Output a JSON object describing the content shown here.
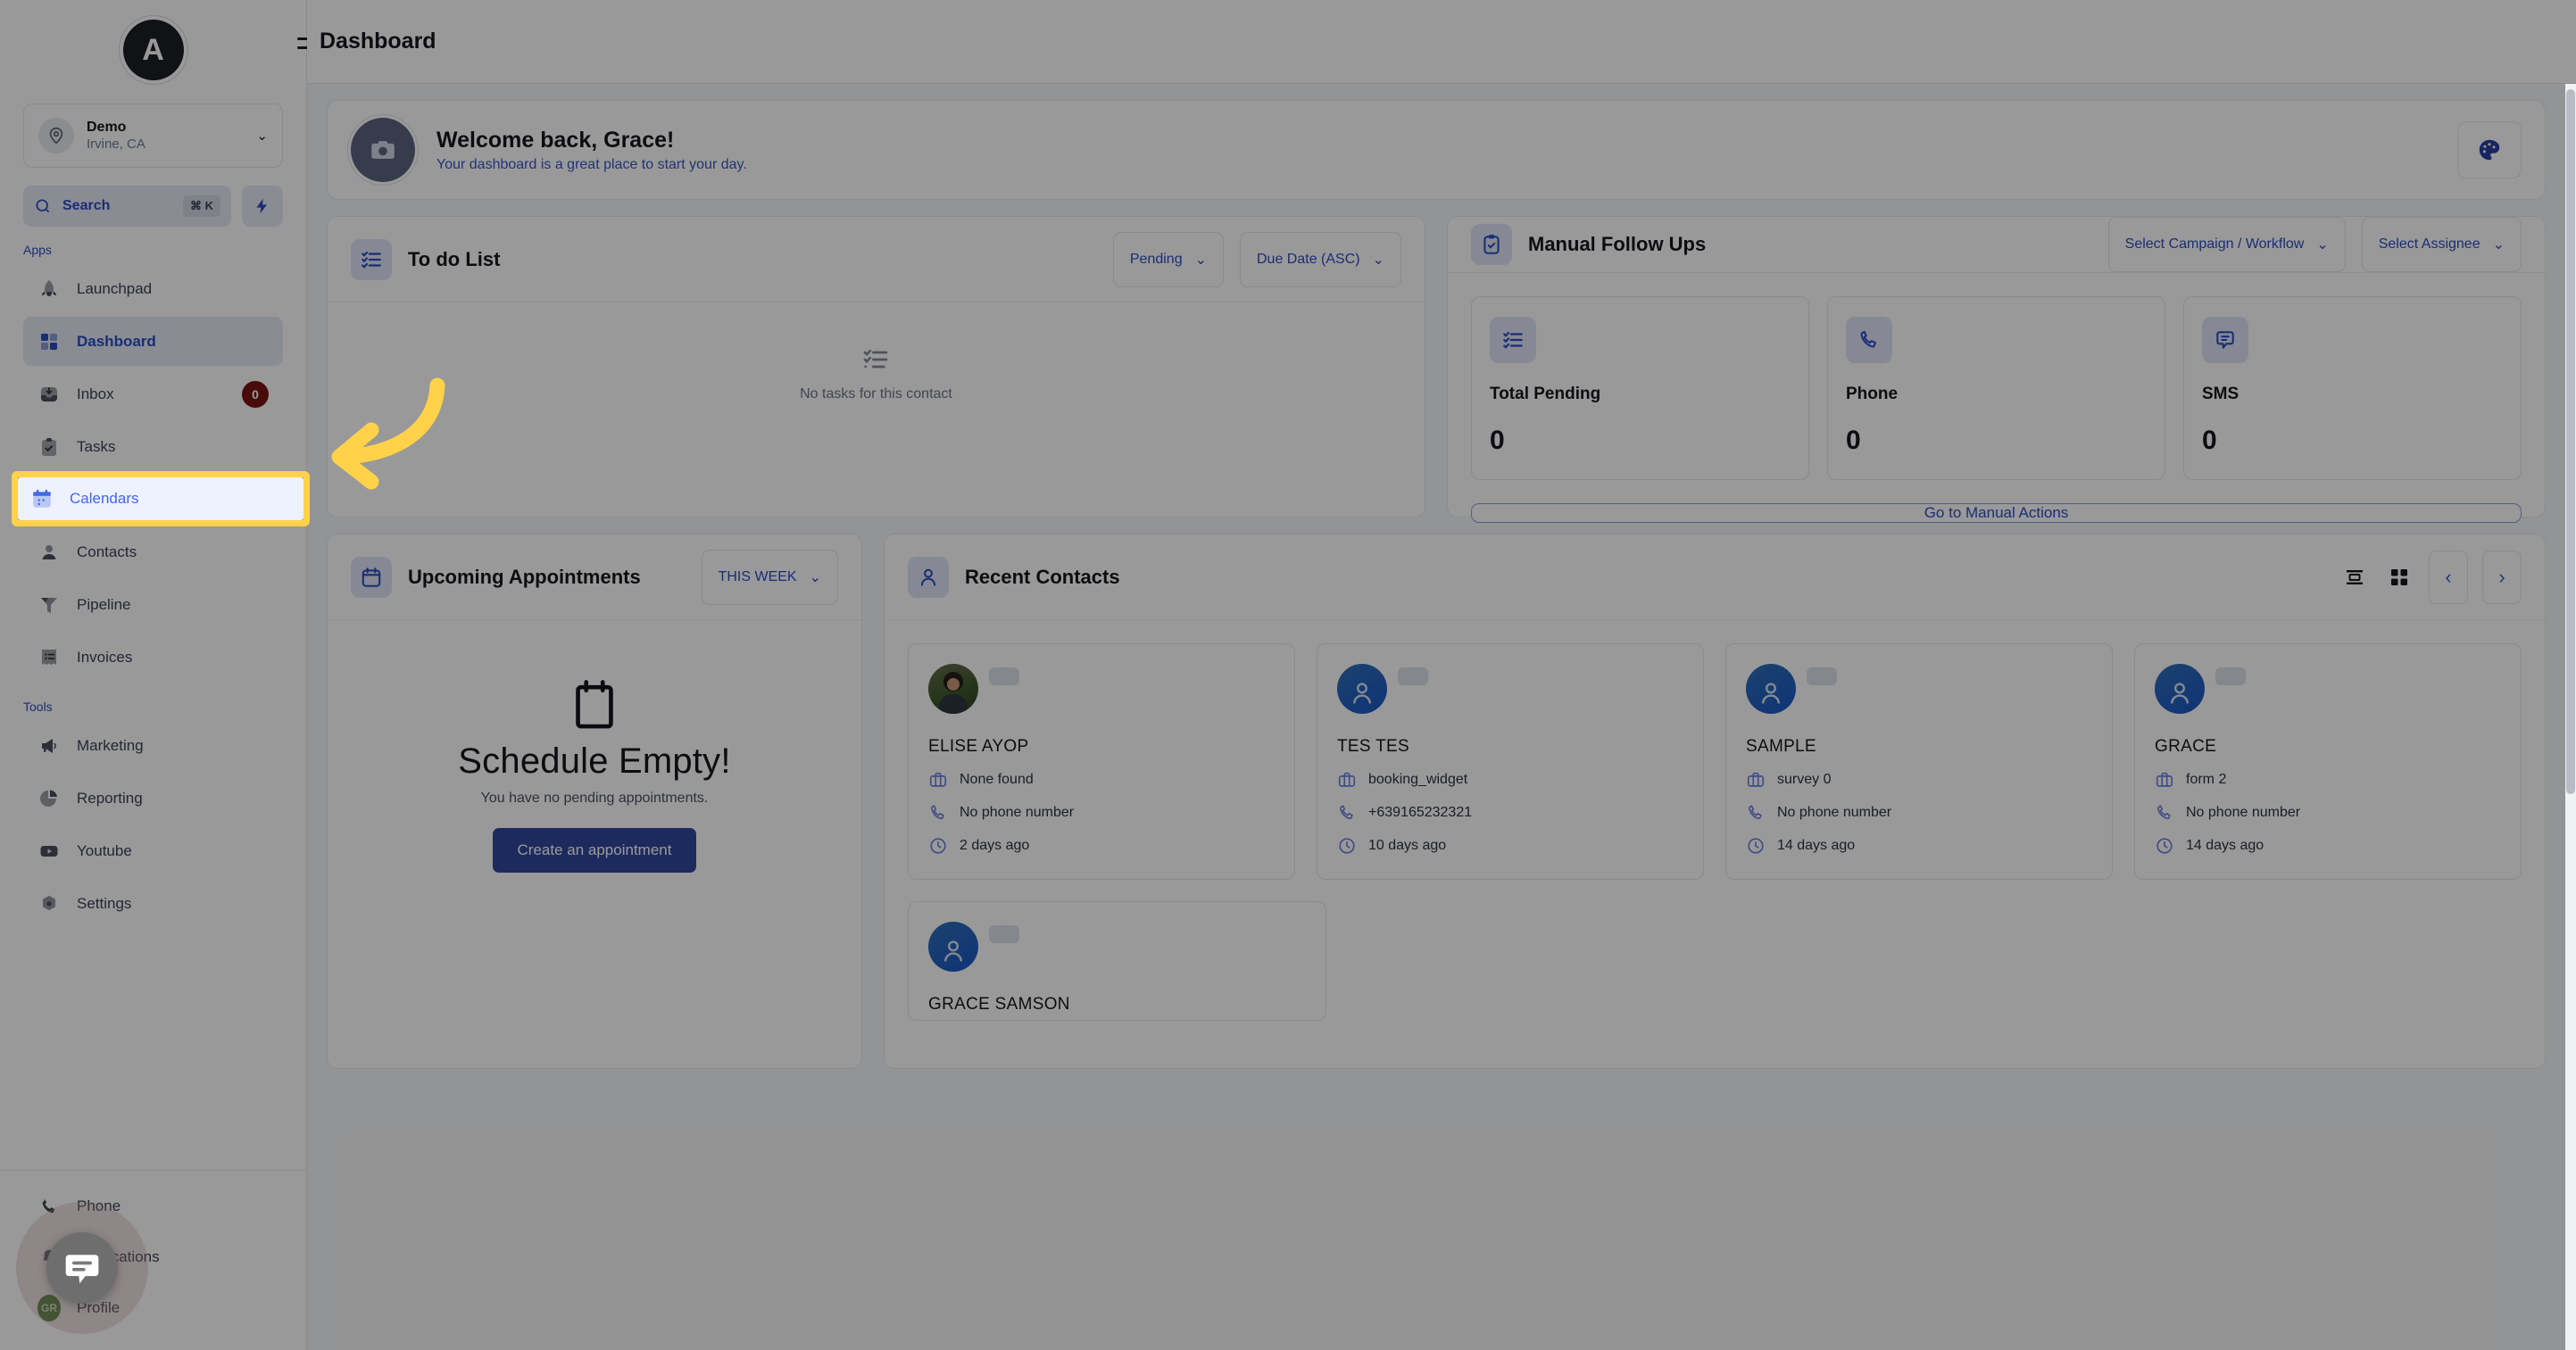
{
  "app": {
    "logo_letter": "A",
    "page_title": "Dashboard"
  },
  "sidebar": {
    "location": {
      "name": "Demo",
      "sub": "Irvine, CA"
    },
    "search": {
      "label": "Search",
      "shortcut": "⌘ K"
    },
    "group_apps_label": "Apps",
    "group_tools_label": "Tools",
    "apps": [
      {
        "label": "Launchpad",
        "icon": "rocket-icon",
        "badge": ""
      },
      {
        "label": "Dashboard",
        "icon": "grid-icon",
        "badge": ""
      },
      {
        "label": "Inbox",
        "icon": "inbox-icon",
        "badge": "0"
      },
      {
        "label": "Tasks",
        "icon": "clipboard-check-icon",
        "badge": ""
      },
      {
        "label": "Calendars",
        "icon": "calendar-icon",
        "badge": ""
      },
      {
        "label": "Contacts",
        "icon": "person-icon",
        "badge": ""
      },
      {
        "label": "Pipeline",
        "icon": "funnel-icon",
        "badge": ""
      },
      {
        "label": "Invoices",
        "icon": "receipt-icon",
        "badge": ""
      }
    ],
    "tools": [
      {
        "label": "Marketing",
        "icon": "megaphone-icon"
      },
      {
        "label": "Reporting",
        "icon": "pie-chart-icon"
      },
      {
        "label": "Youtube",
        "icon": "youtube-icon"
      },
      {
        "label": "Settings",
        "icon": "gear-icon"
      }
    ],
    "bottom": [
      {
        "label": "Phone",
        "icon": "phone-icon"
      },
      {
        "label": "Notifications",
        "icon": "bell-icon"
      },
      {
        "label": "Profile",
        "icon": "avatar-icon"
      }
    ],
    "profile_initials": "GR"
  },
  "welcome": {
    "title": "Welcome back, Grace!",
    "subtitle": "Your dashboard is a great place to start your day.",
    "avatar_icon": "camera-icon",
    "theme_button_icon": "palette-icon"
  },
  "todo": {
    "title": "To do List",
    "icon": "checklist-icon",
    "filter_status": "Pending",
    "filter_sort": "Due Date (ASC)",
    "empty_text": "No tasks for this contact",
    "empty_icon": "checklist-icon"
  },
  "follow_ups": {
    "title": "Manual Follow Ups",
    "icon": "clipboard-check-icon",
    "filter_campaign": "Select Campaign / Workflow",
    "filter_assignee": "Select Assignee",
    "stats": [
      {
        "label": "Total Pending",
        "value": "0",
        "icon": "checklist-icon"
      },
      {
        "label": "Phone",
        "value": "0",
        "icon": "phone-icon"
      },
      {
        "label": "SMS",
        "value": "0",
        "icon": "sms-icon"
      }
    ],
    "cta": "Go to Manual Actions"
  },
  "appointments": {
    "title": "Upcoming Appointments",
    "icon": "calendar-icon",
    "range": "THIS WEEK",
    "empty_title": "Schedule Empty!",
    "empty_sub": "You have no pending appointments.",
    "cta": "Create an appointment",
    "empty_icon": "calendar-icon"
  },
  "recent_contacts": {
    "title": "Recent Contacts",
    "icon": "user-outline-icon",
    "view_list_icon": "list-view-icon",
    "view_grid_icon": "grid-view-icon",
    "prev_icon": "chevron-left-icon",
    "next_icon": "chevron-right-icon",
    "items": [
      {
        "name": "ELISE AYOP",
        "source": "None found",
        "phone": "No phone number",
        "time": "2 days ago",
        "avatar": "photo"
      },
      {
        "name": "TES TES",
        "source": "booking_widget",
        "phone": "+639165232321",
        "time": "10 days ago",
        "avatar": "initials"
      },
      {
        "name": "SAMPLE",
        "source": "survey 0",
        "phone": "No phone number",
        "time": "14 days ago",
        "avatar": "initials"
      },
      {
        "name": "GRACE",
        "source": "form 2",
        "phone": "No phone number",
        "time": "14 days ago",
        "avatar": "initials"
      }
    ],
    "next_row": [
      {
        "name": "GRACE SAMSON",
        "avatar": "initials"
      }
    ]
  },
  "annotation": {
    "highlight_target": "Calendars",
    "highlight_color": "#ffd24a",
    "arrow_color": "#ffd24a"
  },
  "colors": {
    "accent": "#2b4bc4",
    "highlight": "#ffd24a",
    "badge": "#7a1212",
    "primary_button": "#31479d"
  }
}
